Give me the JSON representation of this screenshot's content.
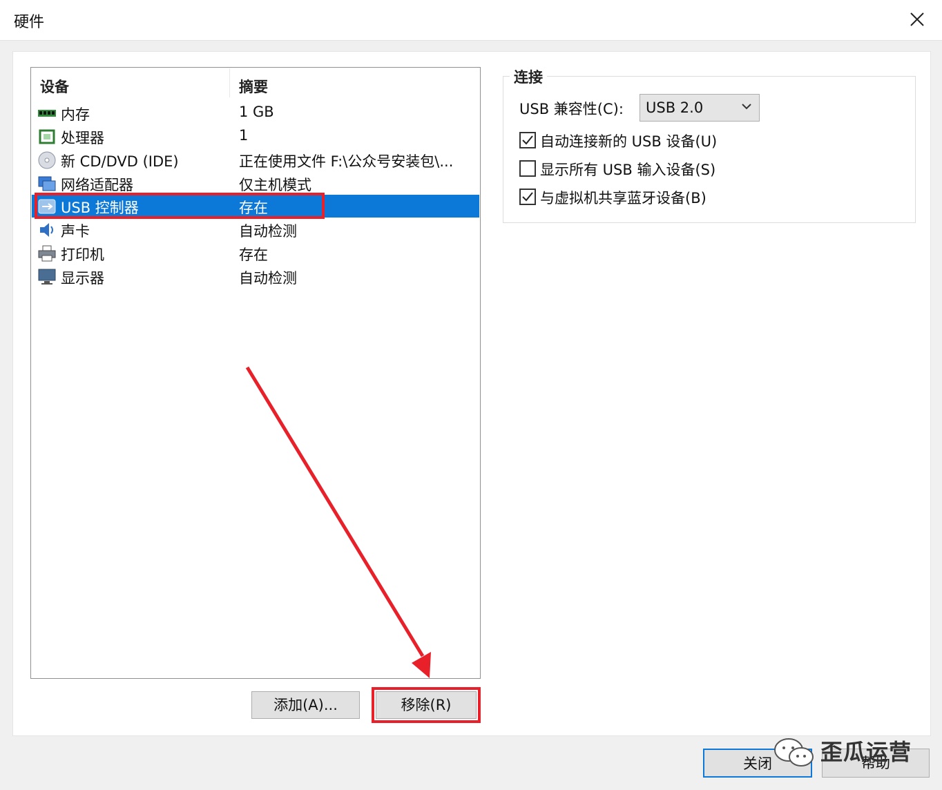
{
  "window": {
    "title": "硬件"
  },
  "device_list": {
    "columns": {
      "device": "设备",
      "summary": "摘要"
    },
    "rows": [
      {
        "name": "内存",
        "summary": "1 GB",
        "icon": "memory-icon"
      },
      {
        "name": "处理器",
        "summary": "1",
        "icon": "processor-icon"
      },
      {
        "name": "新 CD/DVD (IDE)",
        "summary": "正在使用文件 F:\\公众号安装包\\...",
        "icon": "cd-dvd-icon"
      },
      {
        "name": "网络适配器",
        "summary": "仅主机模式",
        "icon": "network-adapter-icon"
      },
      {
        "name": "USB 控制器",
        "summary": "存在",
        "icon": "usb-controller-icon",
        "selected": true
      },
      {
        "name": "声卡",
        "summary": "自动检测",
        "icon": "sound-card-icon"
      },
      {
        "name": "打印机",
        "summary": "存在",
        "icon": "printer-icon"
      },
      {
        "name": "显示器",
        "summary": "自动检测",
        "icon": "display-icon"
      }
    ]
  },
  "buttons": {
    "add": "添加(A)...",
    "remove": "移除(R)",
    "close": "关闭",
    "help": "帮助"
  },
  "connection": {
    "title": "连接",
    "compat_label": "USB 兼容性(C):",
    "compat_value": "USB 2.0",
    "options": [
      {
        "label": "自动连接新的 USB 设备(U)",
        "checked": true
      },
      {
        "label": "显示所有 USB 输入设备(S)",
        "checked": false
      },
      {
        "label": "与虚拟机共享蓝牙设备(B)",
        "checked": true
      }
    ]
  },
  "watermark": {
    "text": "歪瓜运营",
    "icon": "wechat-icon"
  },
  "colors": {
    "selection": "#0c78d8",
    "annotation_red": "#e8202a"
  }
}
